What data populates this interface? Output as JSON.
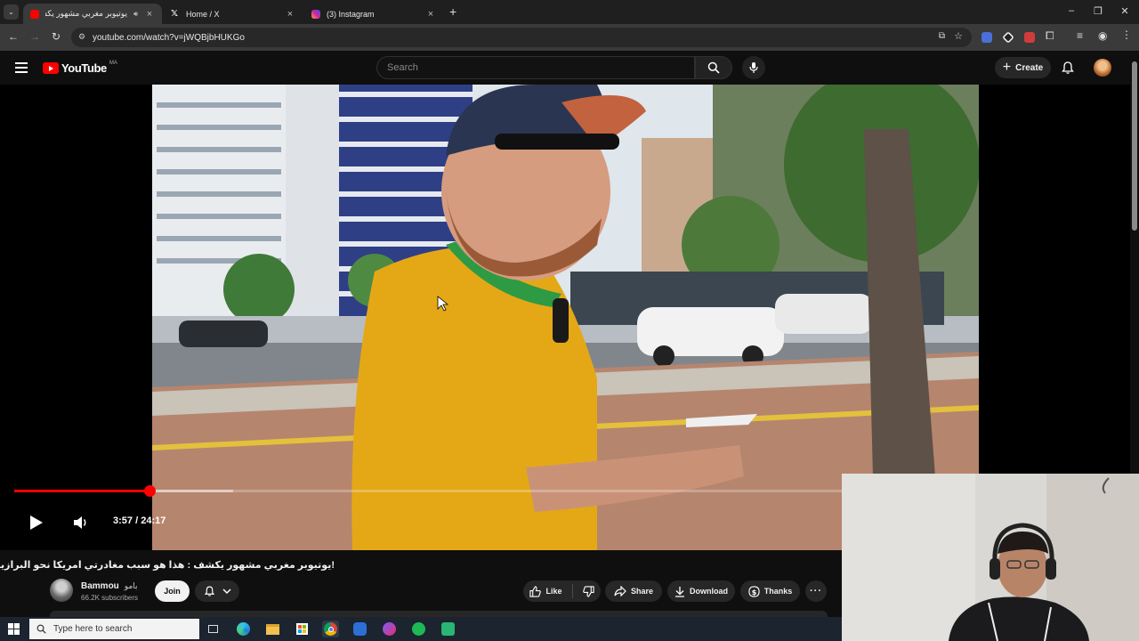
{
  "browser": {
    "tabs": [
      {
        "title": "يوتيوبر مغربي مشهور يكشف",
        "active": true,
        "favicon": "youtube-icon",
        "audio": true
      },
      {
        "title": "Home / X",
        "active": false,
        "favicon": "x-icon"
      },
      {
        "title": "(3) Instagram",
        "active": false,
        "favicon": "instagram-icon"
      }
    ],
    "url": "youtube.com/watch?v=jWQBjbHUKGo"
  },
  "youtube": {
    "logo_text": "YouTube",
    "country_code": "MA",
    "search_placeholder": "Search",
    "create_label": "Create"
  },
  "video": {
    "current_time": "3:57",
    "duration": "24:17",
    "time_display": "3:57 / 24:17",
    "progress_fraction": 0.163,
    "buffered_fraction": 0.265,
    "title": "!يوتيوبر مغربي مشهور يكشف : هذا هو سبب مغادرتي امريكا نحو البرازيل",
    "channel": {
      "name": "Bammou",
      "name_ar": "بامو",
      "subscribers": "66.2K subscribers"
    },
    "join_label": "Join",
    "actions": {
      "like": "Like",
      "share": "Share",
      "download": "Download",
      "thanks": "Thanks"
    }
  },
  "taskbar": {
    "search_placeholder": "Type here to search"
  },
  "colors": {
    "youtube_red": "#ff0000",
    "background": "#0f0f0f",
    "pill": "#272727"
  }
}
